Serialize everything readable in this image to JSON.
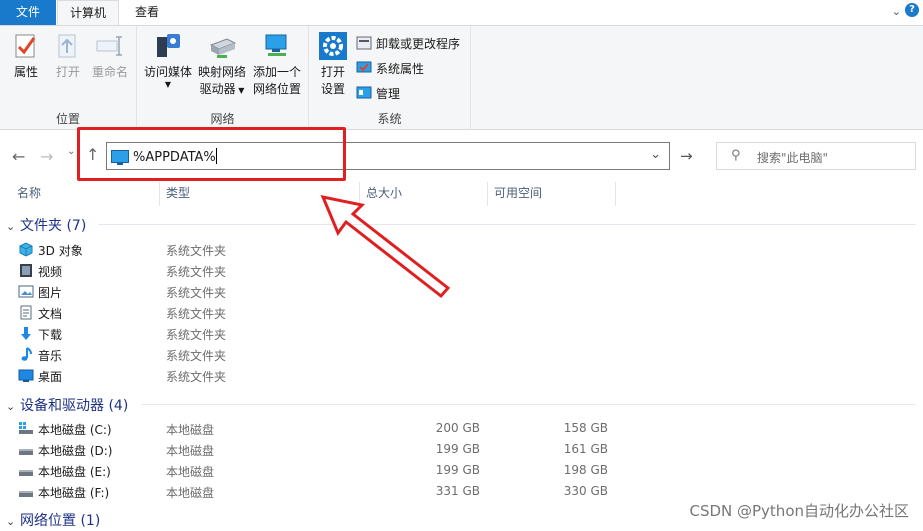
{
  "tabs": {
    "file": "文件",
    "computer": "计算机",
    "view": "查看"
  },
  "ribbon": {
    "location": {
      "label": "位置",
      "properties": "属性",
      "open": "打开",
      "rename": "重命名"
    },
    "network": {
      "label": "网络",
      "media": "访问媒体",
      "map_drive_1": "映射网络",
      "map_drive_2": "驱动器",
      "add_location_1": "添加一个",
      "add_location_2": "网络位置"
    },
    "system": {
      "label": "系统",
      "open_settings_1": "打开",
      "open_settings_2": "设置",
      "uninstall": "卸载或更改程序",
      "sys_props": "系统属性",
      "manage": "管理"
    }
  },
  "address": {
    "value": "%APPDATA%",
    "search_placeholder": "搜索\"此电脑\""
  },
  "columns": {
    "name": "名称",
    "type": "类型",
    "total": "总大小",
    "free": "可用空间"
  },
  "groups": {
    "folders": {
      "label": "文件夹 (7)",
      "items": [
        {
          "name": "3D 对象",
          "type": "系统文件夹",
          "icon": "3d-objects-icon"
        },
        {
          "name": "视频",
          "type": "系统文件夹",
          "icon": "video-icon"
        },
        {
          "name": "图片",
          "type": "系统文件夹",
          "icon": "pictures-icon"
        },
        {
          "name": "文档",
          "type": "系统文件夹",
          "icon": "documents-icon"
        },
        {
          "name": "下载",
          "type": "系统文件夹",
          "icon": "download-icon"
        },
        {
          "name": "音乐",
          "type": "系统文件夹",
          "icon": "music-icon"
        },
        {
          "name": "桌面",
          "type": "系统文件夹",
          "icon": "desktop-icon"
        }
      ]
    },
    "drives": {
      "label": "设备和驱动器 (4)",
      "items": [
        {
          "name": "本地磁盘 (C:)",
          "type": "本地磁盘",
          "total": "200 GB",
          "free": "158 GB"
        },
        {
          "name": "本地磁盘 (D:)",
          "type": "本地磁盘",
          "total": "199 GB",
          "free": "161 GB"
        },
        {
          "name": "本地磁盘 (E:)",
          "type": "本地磁盘",
          "total": "199 GB",
          "free": "198 GB"
        },
        {
          "name": "本地磁盘 (F:)",
          "type": "本地磁盘",
          "total": "331 GB",
          "free": "330 GB"
        }
      ]
    },
    "network": {
      "label": "网络位置 (1)"
    }
  },
  "watermark": "CSDN @Python自动化办公社区",
  "colors": {
    "accent": "#1979ca",
    "annotation": "#e02020",
    "group_text": "#1e3287"
  }
}
